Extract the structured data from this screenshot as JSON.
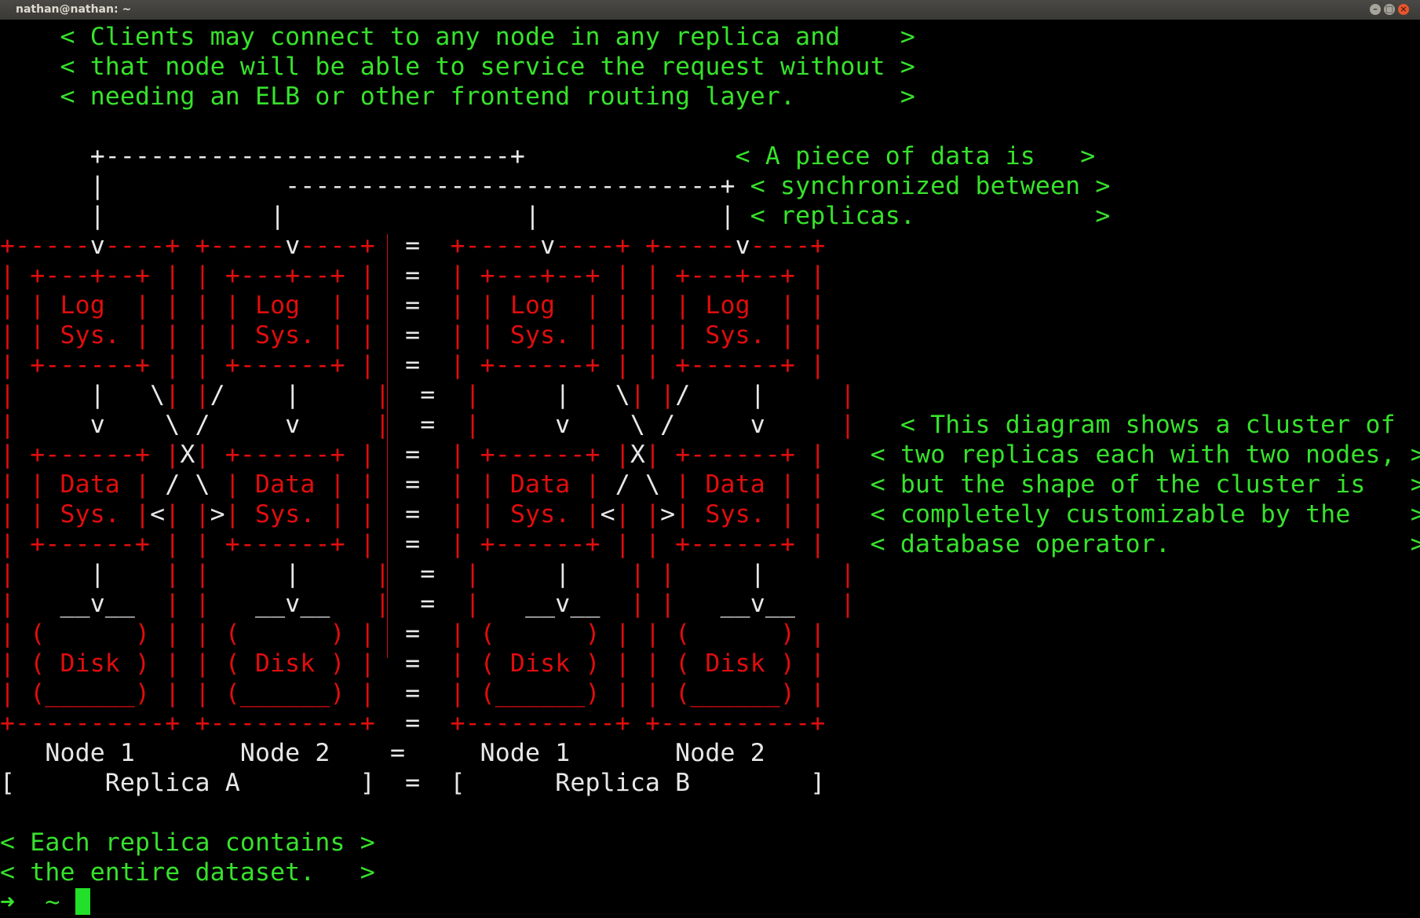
{
  "window": {
    "title": "nathan@nathan: ~"
  },
  "terminal": {
    "lines": [
      [
        {
          "c": "g",
          "t": "    < Clients may connect to any node in any replica and    >"
        }
      ],
      [
        {
          "c": "g",
          "t": "    < that node will be able to service the request without >"
        }
      ],
      [
        {
          "c": "g",
          "t": "    < needing an ELB or other frontend routing layer.       >"
        }
      ],
      [
        {
          "c": "g",
          "t": ""
        }
      ],
      [
        {
          "c": "w",
          "t": "      +---------------------------+              "
        },
        {
          "c": "g",
          "t": "< A piece of data is   >"
        }
      ],
      [
        {
          "c": "w",
          "t": "      |            -----------------------------+ "
        },
        {
          "c": "g",
          "t": "< synchronized between >"
        }
      ],
      [
        {
          "c": "w",
          "t": "      |           |                |            | "
        },
        {
          "c": "g",
          "t": "< replicas.            >"
        }
      ],
      [
        {
          "c": "r",
          "t": "+-----"
        },
        {
          "c": "w",
          "t": "v"
        },
        {
          "c": "r",
          "t": "----+ +-----"
        },
        {
          "c": "w",
          "t": "v"
        },
        {
          "c": "r",
          "t": "----+"
        },
        {
          "c": "w",
          "t": "  =  "
        },
        {
          "c": "r",
          "t": "+-----"
        },
        {
          "c": "w",
          "t": "v"
        },
        {
          "c": "r",
          "t": "----+ +-----"
        },
        {
          "c": "w",
          "t": "v"
        },
        {
          "c": "r",
          "t": "----+"
        }
      ],
      [
        {
          "c": "r",
          "t": "| +---+--+ | | +---+--+ |"
        },
        {
          "c": "w",
          "t": "  =  "
        },
        {
          "c": "r",
          "t": "| +---+--+ | | +---+--+ |"
        }
      ],
      [
        {
          "c": "r",
          "t": "| | Log  | | | | Log  | |"
        },
        {
          "c": "w",
          "t": "  =  "
        },
        {
          "c": "r",
          "t": "| | Log  | | | | Log  | |"
        }
      ],
      [
        {
          "c": "r",
          "t": "| | Sys. | | | | Sys. | |"
        },
        {
          "c": "w",
          "t": "  =  "
        },
        {
          "c": "r",
          "t": "| | Sys. | | | | Sys. | |"
        }
      ],
      [
        {
          "c": "r",
          "t": "| +------+ | | +------+ |"
        },
        {
          "c": "w",
          "t": "  =  "
        },
        {
          "c": "r",
          "t": "| +------+ | | +------+ |"
        }
      ],
      [
        {
          "c": "r",
          "t": "|     "
        },
        {
          "c": "w",
          "t": "|   \\"
        },
        {
          "c": "r",
          "t": "| |"
        },
        {
          "c": "w",
          "t": "/    |"
        },
        {
          "c": "r",
          "t": "     |"
        },
        {
          "c": "w",
          "t": "  =  "
        },
        {
          "c": "r",
          "t": "|     "
        },
        {
          "c": "w",
          "t": "|   \\"
        },
        {
          "c": "r",
          "t": "| |"
        },
        {
          "c": "w",
          "t": "/    |"
        },
        {
          "c": "r",
          "t": "     |"
        }
      ],
      [
        {
          "c": "r",
          "t": "|     "
        },
        {
          "c": "w",
          "t": "v    \\ /     v"
        },
        {
          "c": "r",
          "t": "     |"
        },
        {
          "c": "w",
          "t": "  =  "
        },
        {
          "c": "r",
          "t": "|     "
        },
        {
          "c": "w",
          "t": "v    \\ /     v"
        },
        {
          "c": "r",
          "t": "     |   "
        },
        {
          "c": "g",
          "t": "< This diagram shows a cluster of   >"
        }
      ],
      [
        {
          "c": "r",
          "t": "| +------+ |"
        },
        {
          "c": "w",
          "t": "X"
        },
        {
          "c": "r",
          "t": "| +------+ |"
        },
        {
          "c": "w",
          "t": "  =  "
        },
        {
          "c": "r",
          "t": "| +------+ |"
        },
        {
          "c": "w",
          "t": "X"
        },
        {
          "c": "r",
          "t": "| +------+ |   "
        },
        {
          "c": "g",
          "t": "< two replicas each with two nodes, >"
        }
      ],
      [
        {
          "c": "r",
          "t": "| | Data | "
        },
        {
          "c": "w",
          "t": "/ \\"
        },
        {
          "c": "r",
          "t": " | Data | |"
        },
        {
          "c": "w",
          "t": "  =  "
        },
        {
          "c": "r",
          "t": "| | Data | "
        },
        {
          "c": "w",
          "t": "/ \\"
        },
        {
          "c": "r",
          "t": " | Data | |   "
        },
        {
          "c": "g",
          "t": "< but the shape of the cluster is   >"
        }
      ],
      [
        {
          "c": "r",
          "t": "| | Sys. |"
        },
        {
          "c": "w",
          "t": "<"
        },
        {
          "c": "r",
          "t": "| |"
        },
        {
          "c": "w",
          "t": ">"
        },
        {
          "c": "r",
          "t": "| Sys. | |"
        },
        {
          "c": "w",
          "t": "  =  "
        },
        {
          "c": "r",
          "t": "| | Sys. |"
        },
        {
          "c": "w",
          "t": "<"
        },
        {
          "c": "r",
          "t": "| |"
        },
        {
          "c": "w",
          "t": ">"
        },
        {
          "c": "r",
          "t": "| Sys. | |   "
        },
        {
          "c": "g",
          "t": "< completely customizable by the    >"
        }
      ],
      [
        {
          "c": "r",
          "t": "| +------+ | | +------+ |"
        },
        {
          "c": "w",
          "t": "  =  "
        },
        {
          "c": "r",
          "t": "| +------+ | | +------+ |   "
        },
        {
          "c": "g",
          "t": "< database operator.                >"
        }
      ],
      [
        {
          "c": "r",
          "t": "|     "
        },
        {
          "c": "w",
          "t": "|"
        },
        {
          "c": "r",
          "t": "    | |     "
        },
        {
          "c": "w",
          "t": "|"
        },
        {
          "c": "r",
          "t": "     |"
        },
        {
          "c": "w",
          "t": "  =  "
        },
        {
          "c": "r",
          "t": "|     "
        },
        {
          "c": "w",
          "t": "|"
        },
        {
          "c": "r",
          "t": "    | |     "
        },
        {
          "c": "w",
          "t": "|"
        },
        {
          "c": "r",
          "t": "     |"
        }
      ],
      [
        {
          "c": "r",
          "t": "|   "
        },
        {
          "c": "w",
          "t": "__v__"
        },
        {
          "c": "r",
          "t": "  | |   "
        },
        {
          "c": "w",
          "t": "__v__"
        },
        {
          "c": "r",
          "t": "   |"
        },
        {
          "c": "w",
          "t": "  =  "
        },
        {
          "c": "r",
          "t": "|   "
        },
        {
          "c": "w",
          "t": "__v__"
        },
        {
          "c": "r",
          "t": "  | |   "
        },
        {
          "c": "w",
          "t": "__v__"
        },
        {
          "c": "r",
          "t": "   |"
        }
      ],
      [
        {
          "c": "r",
          "t": "| (      ) | | (      ) |"
        },
        {
          "c": "w",
          "t": "  =  "
        },
        {
          "c": "r",
          "t": "| (      ) | | (      ) |"
        }
      ],
      [
        {
          "c": "r",
          "t": "| ( Disk ) | | ( Disk ) |"
        },
        {
          "c": "w",
          "t": "  =  "
        },
        {
          "c": "r",
          "t": "| ( Disk ) | | ( Disk ) |"
        }
      ],
      [
        {
          "c": "r",
          "t": "| (______) | | (______) |"
        },
        {
          "c": "w",
          "t": "  =  "
        },
        {
          "c": "r",
          "t": "| (______) | | (______) |"
        }
      ],
      [
        {
          "c": "r",
          "t": "+----------+ +----------+"
        },
        {
          "c": "w",
          "t": "  =  "
        },
        {
          "c": "r",
          "t": "+----------+ +----------+"
        }
      ],
      [
        {
          "c": "w",
          "t": "   Node 1       Node 2    =     Node 1       Node 2"
        }
      ],
      [
        {
          "c": "w",
          "t": "[      Replica A        ]  =  [      Replica B        ]"
        }
      ],
      [
        {
          "c": "g",
          "t": ""
        }
      ],
      [
        {
          "c": "g",
          "t": "< Each replica contains >"
        }
      ],
      [
        {
          "c": "g",
          "t": "< the entire dataset.   >"
        }
      ]
    ],
    "prompt": {
      "arrow": "➜",
      "dir": "~"
    }
  },
  "colors": {
    "green": "#37e22c",
    "red": "#e00d0d",
    "white": "#e8e8e8",
    "background": "#000000"
  }
}
